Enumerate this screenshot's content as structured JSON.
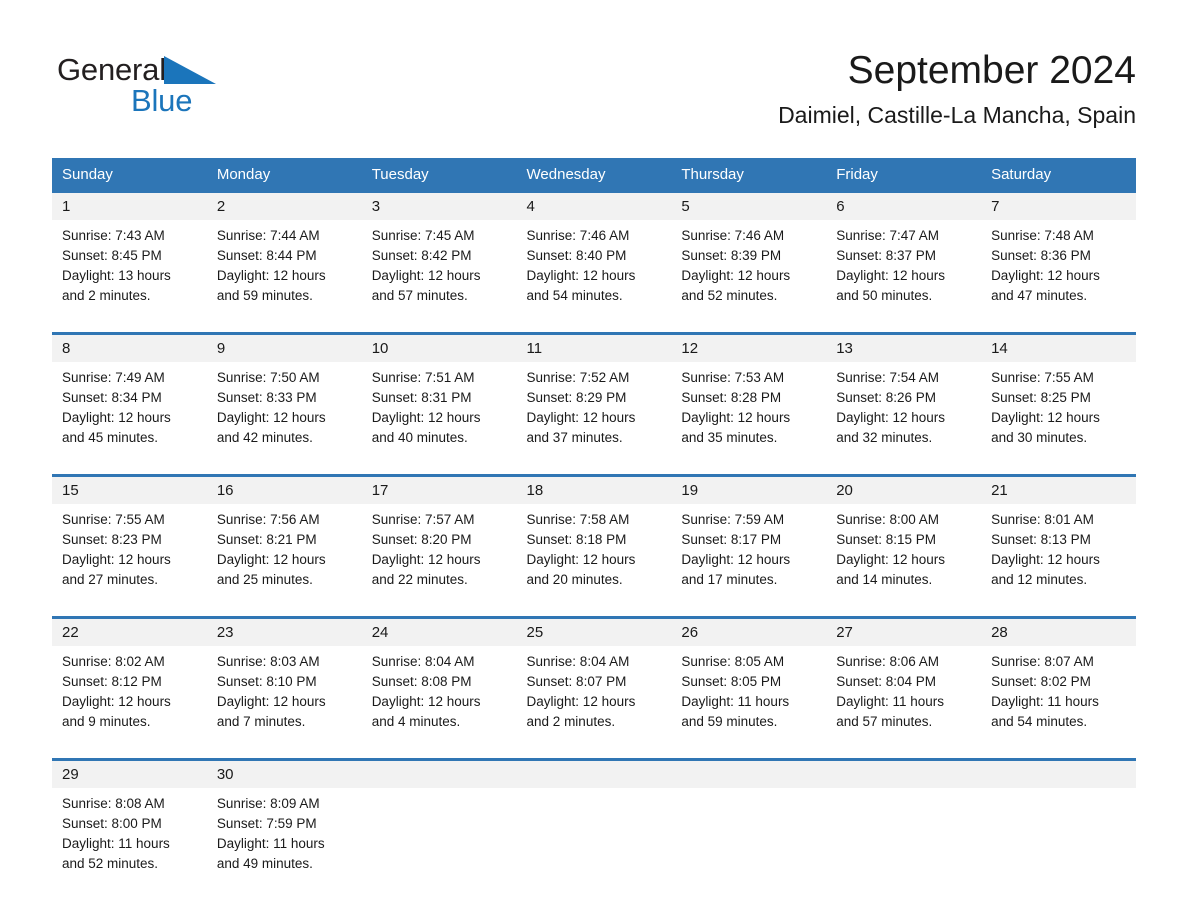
{
  "brand": {
    "name_part1": "General",
    "name_part2": "Blue",
    "triangle_color": "#1b75bb"
  },
  "header": {
    "title": "September 2024",
    "subtitle": "Daimiel, Castille-La Mancha, Spain"
  },
  "theme": {
    "header_blue": "#3076b4",
    "daynum_gray": "#f2f2f2",
    "text_dark": "#1a1a1a"
  },
  "weekdays": [
    "Sunday",
    "Monday",
    "Tuesday",
    "Wednesday",
    "Thursday",
    "Friday",
    "Saturday"
  ],
  "weeks": [
    {
      "days": [
        {
          "date": "1",
          "sunrise": "Sunrise: 7:43 AM",
          "sunset": "Sunset: 8:45 PM",
          "daylight_line1": "Daylight: 13 hours",
          "daylight_line2": "and 2 minutes."
        },
        {
          "date": "2",
          "sunrise": "Sunrise: 7:44 AM",
          "sunset": "Sunset: 8:44 PM",
          "daylight_line1": "Daylight: 12 hours",
          "daylight_line2": "and 59 minutes."
        },
        {
          "date": "3",
          "sunrise": "Sunrise: 7:45 AM",
          "sunset": "Sunset: 8:42 PM",
          "daylight_line1": "Daylight: 12 hours",
          "daylight_line2": "and 57 minutes."
        },
        {
          "date": "4",
          "sunrise": "Sunrise: 7:46 AM",
          "sunset": "Sunset: 8:40 PM",
          "daylight_line1": "Daylight: 12 hours",
          "daylight_line2": "and 54 minutes."
        },
        {
          "date": "5",
          "sunrise": "Sunrise: 7:46 AM",
          "sunset": "Sunset: 8:39 PM",
          "daylight_line1": "Daylight: 12 hours",
          "daylight_line2": "and 52 minutes."
        },
        {
          "date": "6",
          "sunrise": "Sunrise: 7:47 AM",
          "sunset": "Sunset: 8:37 PM",
          "daylight_line1": "Daylight: 12 hours",
          "daylight_line2": "and 50 minutes."
        },
        {
          "date": "7",
          "sunrise": "Sunrise: 7:48 AM",
          "sunset": "Sunset: 8:36 PM",
          "daylight_line1": "Daylight: 12 hours",
          "daylight_line2": "and 47 minutes."
        }
      ]
    },
    {
      "days": [
        {
          "date": "8",
          "sunrise": "Sunrise: 7:49 AM",
          "sunset": "Sunset: 8:34 PM",
          "daylight_line1": "Daylight: 12 hours",
          "daylight_line2": "and 45 minutes."
        },
        {
          "date": "9",
          "sunrise": "Sunrise: 7:50 AM",
          "sunset": "Sunset: 8:33 PM",
          "daylight_line1": "Daylight: 12 hours",
          "daylight_line2": "and 42 minutes."
        },
        {
          "date": "10",
          "sunrise": "Sunrise: 7:51 AM",
          "sunset": "Sunset: 8:31 PM",
          "daylight_line1": "Daylight: 12 hours",
          "daylight_line2": "and 40 minutes."
        },
        {
          "date": "11",
          "sunrise": "Sunrise: 7:52 AM",
          "sunset": "Sunset: 8:29 PM",
          "daylight_line1": "Daylight: 12 hours",
          "daylight_line2": "and 37 minutes."
        },
        {
          "date": "12",
          "sunrise": "Sunrise: 7:53 AM",
          "sunset": "Sunset: 8:28 PM",
          "daylight_line1": "Daylight: 12 hours",
          "daylight_line2": "and 35 minutes."
        },
        {
          "date": "13",
          "sunrise": "Sunrise: 7:54 AM",
          "sunset": "Sunset: 8:26 PM",
          "daylight_line1": "Daylight: 12 hours",
          "daylight_line2": "and 32 minutes."
        },
        {
          "date": "14",
          "sunrise": "Sunrise: 7:55 AM",
          "sunset": "Sunset: 8:25 PM",
          "daylight_line1": "Daylight: 12 hours",
          "daylight_line2": "and 30 minutes."
        }
      ]
    },
    {
      "days": [
        {
          "date": "15",
          "sunrise": "Sunrise: 7:55 AM",
          "sunset": "Sunset: 8:23 PM",
          "daylight_line1": "Daylight: 12 hours",
          "daylight_line2": "and 27 minutes."
        },
        {
          "date": "16",
          "sunrise": "Sunrise: 7:56 AM",
          "sunset": "Sunset: 8:21 PM",
          "daylight_line1": "Daylight: 12 hours",
          "daylight_line2": "and 25 minutes."
        },
        {
          "date": "17",
          "sunrise": "Sunrise: 7:57 AM",
          "sunset": "Sunset: 8:20 PM",
          "daylight_line1": "Daylight: 12 hours",
          "daylight_line2": "and 22 minutes."
        },
        {
          "date": "18",
          "sunrise": "Sunrise: 7:58 AM",
          "sunset": "Sunset: 8:18 PM",
          "daylight_line1": "Daylight: 12 hours",
          "daylight_line2": "and 20 minutes."
        },
        {
          "date": "19",
          "sunrise": "Sunrise: 7:59 AM",
          "sunset": "Sunset: 8:17 PM",
          "daylight_line1": "Daylight: 12 hours",
          "daylight_line2": "and 17 minutes."
        },
        {
          "date": "20",
          "sunrise": "Sunrise: 8:00 AM",
          "sunset": "Sunset: 8:15 PM",
          "daylight_line1": "Daylight: 12 hours",
          "daylight_line2": "and 14 minutes."
        },
        {
          "date": "21",
          "sunrise": "Sunrise: 8:01 AM",
          "sunset": "Sunset: 8:13 PM",
          "daylight_line1": "Daylight: 12 hours",
          "daylight_line2": "and 12 minutes."
        }
      ]
    },
    {
      "days": [
        {
          "date": "22",
          "sunrise": "Sunrise: 8:02 AM",
          "sunset": "Sunset: 8:12 PM",
          "daylight_line1": "Daylight: 12 hours",
          "daylight_line2": "and 9 minutes."
        },
        {
          "date": "23",
          "sunrise": "Sunrise: 8:03 AM",
          "sunset": "Sunset: 8:10 PM",
          "daylight_line1": "Daylight: 12 hours",
          "daylight_line2": "and 7 minutes."
        },
        {
          "date": "24",
          "sunrise": "Sunrise: 8:04 AM",
          "sunset": "Sunset: 8:08 PM",
          "daylight_line1": "Daylight: 12 hours",
          "daylight_line2": "and 4 minutes."
        },
        {
          "date": "25",
          "sunrise": "Sunrise: 8:04 AM",
          "sunset": "Sunset: 8:07 PM",
          "daylight_line1": "Daylight: 12 hours",
          "daylight_line2": "and 2 minutes."
        },
        {
          "date": "26",
          "sunrise": "Sunrise: 8:05 AM",
          "sunset": "Sunset: 8:05 PM",
          "daylight_line1": "Daylight: 11 hours",
          "daylight_line2": "and 59 minutes."
        },
        {
          "date": "27",
          "sunrise": "Sunrise: 8:06 AM",
          "sunset": "Sunset: 8:04 PM",
          "daylight_line1": "Daylight: 11 hours",
          "daylight_line2": "and 57 minutes."
        },
        {
          "date": "28",
          "sunrise": "Sunrise: 8:07 AM",
          "sunset": "Sunset: 8:02 PM",
          "daylight_line1": "Daylight: 11 hours",
          "daylight_line2": "and 54 minutes."
        }
      ]
    },
    {
      "days": [
        {
          "date": "29",
          "sunrise": "Sunrise: 8:08 AM",
          "sunset": "Sunset: 8:00 PM",
          "daylight_line1": "Daylight: 11 hours",
          "daylight_line2": "and 52 minutes."
        },
        {
          "date": "30",
          "sunrise": "Sunrise: 8:09 AM",
          "sunset": "Sunset: 7:59 PM",
          "daylight_line1": "Daylight: 11 hours",
          "daylight_line2": "and 49 minutes."
        },
        {
          "date": "",
          "sunrise": "",
          "sunset": "",
          "daylight_line1": "",
          "daylight_line2": ""
        },
        {
          "date": "",
          "sunrise": "",
          "sunset": "",
          "daylight_line1": "",
          "daylight_line2": ""
        },
        {
          "date": "",
          "sunrise": "",
          "sunset": "",
          "daylight_line1": "",
          "daylight_line2": ""
        },
        {
          "date": "",
          "sunrise": "",
          "sunset": "",
          "daylight_line1": "",
          "daylight_line2": ""
        },
        {
          "date": "",
          "sunrise": "",
          "sunset": "",
          "daylight_line1": "",
          "daylight_line2": ""
        }
      ]
    }
  ]
}
